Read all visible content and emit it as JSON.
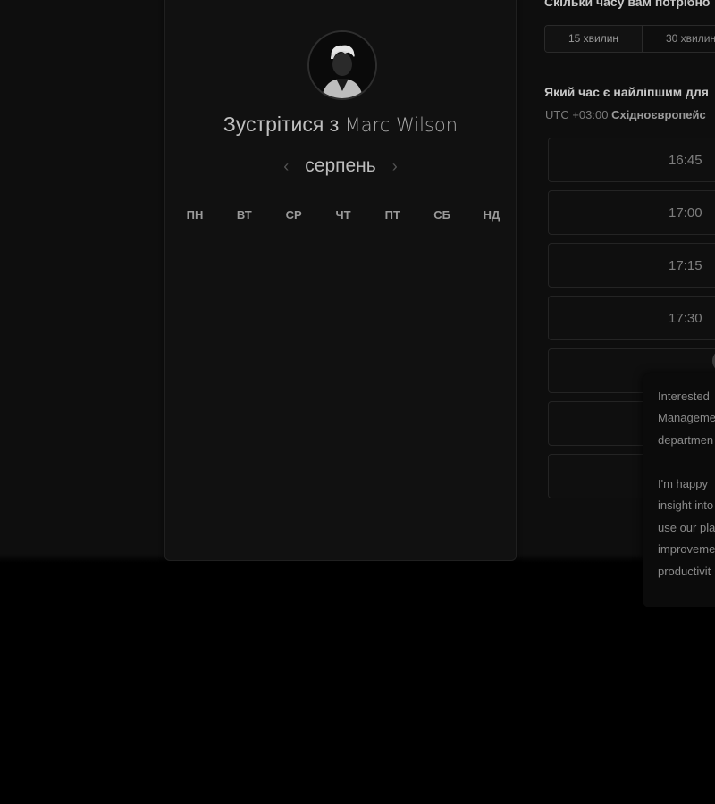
{
  "booking_card": {
    "avatar_alt": "Marc Wilson avatar",
    "title_prefix": "Зустрітися з",
    "host_name": "Marc Wilson",
    "month": "серпень",
    "prev_icon": "chevron-left-icon",
    "next_icon": "chevron-right-icon",
    "weekdays": [
      "ПН",
      "ВТ",
      "СР",
      "ЧТ",
      "ПТ",
      "СБ",
      "НД"
    ]
  },
  "duration": {
    "question": "Скільки часу вам потрібно",
    "options": [
      "15 хвилин",
      "30 хвилин"
    ],
    "selected": "15 хвилин"
  },
  "time_picker": {
    "question": "Який час є найліпшим для",
    "timezone_offset": "UTC +03:00",
    "timezone_name": "Східноєвропейс",
    "slots": [
      "16:45",
      "17:00",
      "17:15",
      "17:30",
      "",
      "",
      ""
    ]
  },
  "chat_popup": {
    "lines": [
      "Interested",
      "Manageme",
      "departmen",
      "",
      "I'm happy",
      "insight into",
      "use our pla",
      "improveme",
      "productivit"
    ]
  }
}
